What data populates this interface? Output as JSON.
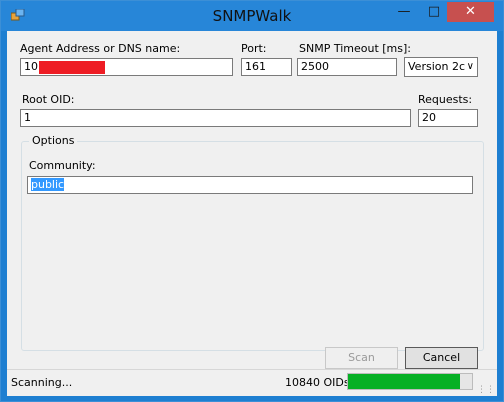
{
  "window": {
    "title": "SNMPWalk",
    "minimize_icon": "minimize-icon",
    "maximize_icon": "maximize-icon",
    "close_icon": "close-icon",
    "close_color": "#c7504f"
  },
  "agent": {
    "label": "Agent Address or DNS name:",
    "value": "10"
  },
  "port": {
    "label": "Port:",
    "value": "161"
  },
  "timeout": {
    "label": "SNMP Timeout [ms]:",
    "value": "2500"
  },
  "version": {
    "value": "Version 2c"
  },
  "root_oid": {
    "label": "Root OID:",
    "value": "1"
  },
  "requests": {
    "label": "Requests:",
    "value": "20"
  },
  "options": {
    "title": "Options",
    "community_label": "Community:",
    "community_value": "public"
  },
  "buttons": {
    "scan": "Scan",
    "cancel": "Cancel"
  },
  "status": {
    "text": "Scanning...",
    "oid_count": "10840 OIDs",
    "progress_fraction": 0.9,
    "progress_color": "#06b025"
  }
}
